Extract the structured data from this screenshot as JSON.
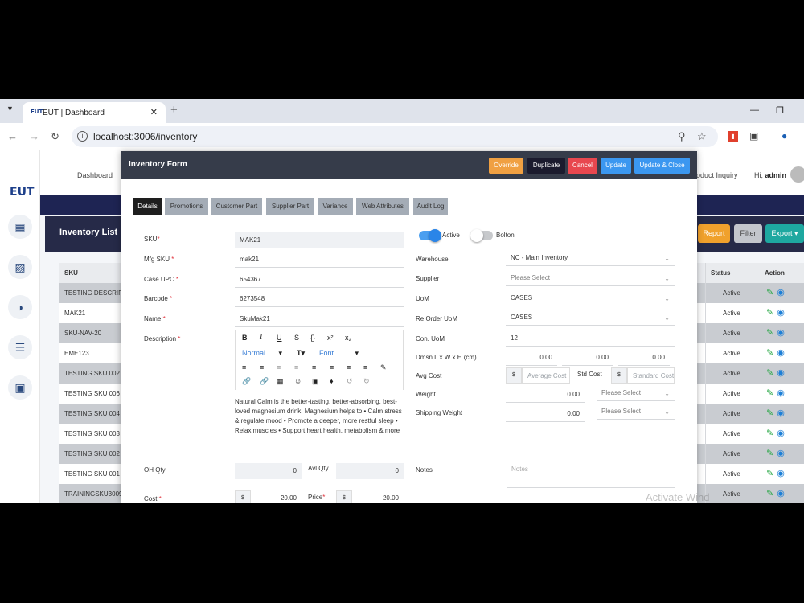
{
  "browser": {
    "tab_title": "EUT | Dashboard",
    "tab_favicon": "EUT",
    "url": "localhost:3006/inventory"
  },
  "app": {
    "logo": "EUT",
    "nav": {
      "dashboard": "Dashboard",
      "product_inquiry": "roduct Inquiry",
      "greeting": "Hi, ",
      "user": "admin"
    },
    "list_title": "Inventory List",
    "buttons": {
      "report": "Report",
      "filter": "Filter",
      "export": "Export"
    },
    "table": {
      "headers": {
        "sku": "SKU",
        "status": "Status",
        "action": "Action"
      },
      "rows": [
        {
          "sku": "TESTING DESCRIPTI",
          "status": "Active"
        },
        {
          "sku": "MAK21",
          "status": "Active"
        },
        {
          "sku": "SKU-NAV-20",
          "status": "Active"
        },
        {
          "sku": "EME123",
          "status": "Active"
        },
        {
          "sku": "TESTING SKU 0027",
          "status": "Active"
        },
        {
          "sku": "TESTING SKU 006",
          "status": "Active"
        },
        {
          "sku": "TESTING SKU 004",
          "status": "Active"
        },
        {
          "sku": "TESTING SKU 003",
          "status": "Active"
        },
        {
          "sku": "TESTING SKU 002",
          "status": "Active"
        },
        {
          "sku": "TESTING SKU 001",
          "status": "Active"
        },
        {
          "sku": "TRAININGSKU3009",
          "status": "Active"
        }
      ]
    }
  },
  "modal": {
    "title": "Inventory Form",
    "buttons": {
      "override": "Override",
      "duplicate": "Duplicate",
      "cancel": "Cancel",
      "update": "Update",
      "update_close": "Update & Close"
    },
    "tabs": [
      "Details",
      "Promotions",
      "Customer Part",
      "Supplier Part",
      "Variance",
      "Web Attributes",
      "Audit Log"
    ],
    "labels": {
      "sku": "SKU",
      "mfg_sku": "Mfg SKU ",
      "case_upc": "Case UPC ",
      "barcode": "Barcode ",
      "name": "Name ",
      "description": "Description ",
      "oh_qty": "OH Qty",
      "avl_qty": "Avl Qty",
      "cost": "Cost ",
      "price": "Price",
      "active": "Active",
      "bolton": "Bolton",
      "warehouse": "Warehouse",
      "supplier": "Supplier",
      "uom": "UoM",
      "reorder_uom": "Re Order UoM",
      "con_uom": "Con. UoM",
      "dimensions": "Dmsn L x W x H (cm)",
      "avg_cost": "Avg Cost",
      "std_cost": "Std Cost",
      "weight": "Weight",
      "shipping_weight": "Shipping Weight",
      "notes": "Notes",
      "req": "*"
    },
    "values": {
      "sku": "MAK21",
      "mfg_sku": "mak21",
      "case_upc": "654367",
      "barcode": "6273548",
      "name": "SkuMak21",
      "oh_qty": "0",
      "avl_qty": "0",
      "cost": "20.00",
      "price": "20.00",
      "currency": "$",
      "warehouse": "NC - Main Inventory",
      "supplier": "Please Select",
      "uom": "CASES",
      "reorder_uom": "CASES",
      "con_uom": "12",
      "dim_l": "0.00",
      "dim_w": "0.00",
      "dim_h": "0.00",
      "avg_cost_placeholder": "Average Cost",
      "std_cost_placeholder": "Standard Cost",
      "weight": "0.00",
      "weight_unit": "Please Select",
      "shipping_weight": "0.00",
      "shipping_weight_unit": "Please Select",
      "notes_placeholder": "Notes",
      "description": "Natural Calm is the better-tasting, better-absorbing, best-loved magnesium drink! Magnesium helps to:• Calm stress & regulate mood • Promote a deeper, more restful sleep • Relax muscles • Support heart health, metabolism & more"
    },
    "editor": {
      "format": "Normal",
      "font": "Font"
    },
    "toggles": {
      "active": true,
      "bolton": false
    }
  },
  "watermark": "Activate Wind",
  "colors": {
    "active_tab": "#1e1e1e",
    "override": "#f0a042",
    "duplicate": "#1b1b2e",
    "cancel": "#e8474f",
    "update": "#3b97f0",
    "report": "#f0a12c",
    "export": "#1ea8a0"
  }
}
